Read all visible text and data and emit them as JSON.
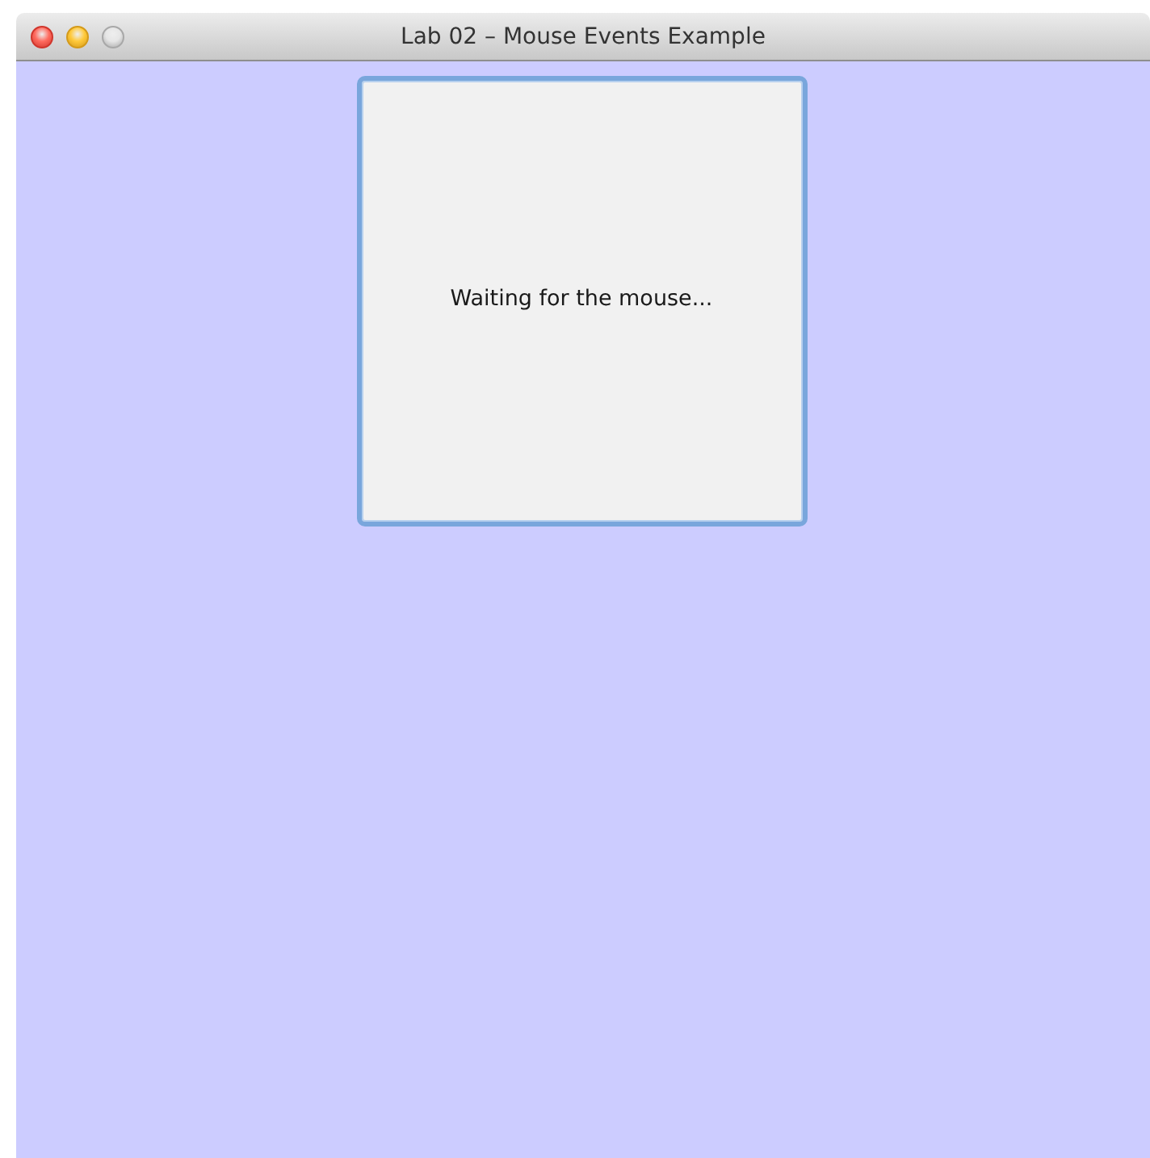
{
  "window": {
    "title": "Lab 02 – Mouse Events Example",
    "controls": [
      {
        "kind": "close"
      },
      {
        "kind": "minimize"
      },
      {
        "kind": "zoom"
      }
    ]
  },
  "panel": {
    "label": "Waiting for the mouse...",
    "focused": true
  }
}
